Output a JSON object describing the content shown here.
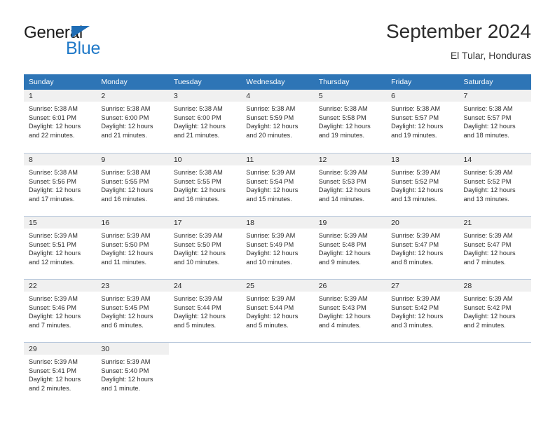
{
  "brand": {
    "name_part1": "General",
    "name_part2": "Blue",
    "logo_icon": "triangle-logo-icon"
  },
  "header": {
    "title": "September 2024",
    "location": "El Tular, Honduras"
  },
  "calendar": {
    "weekday_headers": [
      "Sunday",
      "Monday",
      "Tuesday",
      "Wednesday",
      "Thursday",
      "Friday",
      "Saturday"
    ],
    "header_bg_color": "#2e75b6",
    "daynum_band_color": "#f0f0f0",
    "grid_line_color": "#b9c9dc",
    "weeks": [
      [
        {
          "day": "1",
          "sunrise": "Sunrise: 5:38 AM",
          "sunset": "Sunset: 6:01 PM",
          "daylight_1": "Daylight: 12 hours",
          "daylight_2": "and 22 minutes."
        },
        {
          "day": "2",
          "sunrise": "Sunrise: 5:38 AM",
          "sunset": "Sunset: 6:00 PM",
          "daylight_1": "Daylight: 12 hours",
          "daylight_2": "and 21 minutes."
        },
        {
          "day": "3",
          "sunrise": "Sunrise: 5:38 AM",
          "sunset": "Sunset: 6:00 PM",
          "daylight_1": "Daylight: 12 hours",
          "daylight_2": "and 21 minutes."
        },
        {
          "day": "4",
          "sunrise": "Sunrise: 5:38 AM",
          "sunset": "Sunset: 5:59 PM",
          "daylight_1": "Daylight: 12 hours",
          "daylight_2": "and 20 minutes."
        },
        {
          "day": "5",
          "sunrise": "Sunrise: 5:38 AM",
          "sunset": "Sunset: 5:58 PM",
          "daylight_1": "Daylight: 12 hours",
          "daylight_2": "and 19 minutes."
        },
        {
          "day": "6",
          "sunrise": "Sunrise: 5:38 AM",
          "sunset": "Sunset: 5:57 PM",
          "daylight_1": "Daylight: 12 hours",
          "daylight_2": "and 19 minutes."
        },
        {
          "day": "7",
          "sunrise": "Sunrise: 5:38 AM",
          "sunset": "Sunset: 5:57 PM",
          "daylight_1": "Daylight: 12 hours",
          "daylight_2": "and 18 minutes."
        }
      ],
      [
        {
          "day": "8",
          "sunrise": "Sunrise: 5:38 AM",
          "sunset": "Sunset: 5:56 PM",
          "daylight_1": "Daylight: 12 hours",
          "daylight_2": "and 17 minutes."
        },
        {
          "day": "9",
          "sunrise": "Sunrise: 5:38 AM",
          "sunset": "Sunset: 5:55 PM",
          "daylight_1": "Daylight: 12 hours",
          "daylight_2": "and 16 minutes."
        },
        {
          "day": "10",
          "sunrise": "Sunrise: 5:38 AM",
          "sunset": "Sunset: 5:55 PM",
          "daylight_1": "Daylight: 12 hours",
          "daylight_2": "and 16 minutes."
        },
        {
          "day": "11",
          "sunrise": "Sunrise: 5:39 AM",
          "sunset": "Sunset: 5:54 PM",
          "daylight_1": "Daylight: 12 hours",
          "daylight_2": "and 15 minutes."
        },
        {
          "day": "12",
          "sunrise": "Sunrise: 5:39 AM",
          "sunset": "Sunset: 5:53 PM",
          "daylight_1": "Daylight: 12 hours",
          "daylight_2": "and 14 minutes."
        },
        {
          "day": "13",
          "sunrise": "Sunrise: 5:39 AM",
          "sunset": "Sunset: 5:52 PM",
          "daylight_1": "Daylight: 12 hours",
          "daylight_2": "and 13 minutes."
        },
        {
          "day": "14",
          "sunrise": "Sunrise: 5:39 AM",
          "sunset": "Sunset: 5:52 PM",
          "daylight_1": "Daylight: 12 hours",
          "daylight_2": "and 13 minutes."
        }
      ],
      [
        {
          "day": "15",
          "sunrise": "Sunrise: 5:39 AM",
          "sunset": "Sunset: 5:51 PM",
          "daylight_1": "Daylight: 12 hours",
          "daylight_2": "and 12 minutes."
        },
        {
          "day": "16",
          "sunrise": "Sunrise: 5:39 AM",
          "sunset": "Sunset: 5:50 PM",
          "daylight_1": "Daylight: 12 hours",
          "daylight_2": "and 11 minutes."
        },
        {
          "day": "17",
          "sunrise": "Sunrise: 5:39 AM",
          "sunset": "Sunset: 5:50 PM",
          "daylight_1": "Daylight: 12 hours",
          "daylight_2": "and 10 minutes."
        },
        {
          "day": "18",
          "sunrise": "Sunrise: 5:39 AM",
          "sunset": "Sunset: 5:49 PM",
          "daylight_1": "Daylight: 12 hours",
          "daylight_2": "and 10 minutes."
        },
        {
          "day": "19",
          "sunrise": "Sunrise: 5:39 AM",
          "sunset": "Sunset: 5:48 PM",
          "daylight_1": "Daylight: 12 hours",
          "daylight_2": "and 9 minutes."
        },
        {
          "day": "20",
          "sunrise": "Sunrise: 5:39 AM",
          "sunset": "Sunset: 5:47 PM",
          "daylight_1": "Daylight: 12 hours",
          "daylight_2": "and 8 minutes."
        },
        {
          "day": "21",
          "sunrise": "Sunrise: 5:39 AM",
          "sunset": "Sunset: 5:47 PM",
          "daylight_1": "Daylight: 12 hours",
          "daylight_2": "and 7 minutes."
        }
      ],
      [
        {
          "day": "22",
          "sunrise": "Sunrise: 5:39 AM",
          "sunset": "Sunset: 5:46 PM",
          "daylight_1": "Daylight: 12 hours",
          "daylight_2": "and 7 minutes."
        },
        {
          "day": "23",
          "sunrise": "Sunrise: 5:39 AM",
          "sunset": "Sunset: 5:45 PM",
          "daylight_1": "Daylight: 12 hours",
          "daylight_2": "and 6 minutes."
        },
        {
          "day": "24",
          "sunrise": "Sunrise: 5:39 AM",
          "sunset": "Sunset: 5:44 PM",
          "daylight_1": "Daylight: 12 hours",
          "daylight_2": "and 5 minutes."
        },
        {
          "day": "25",
          "sunrise": "Sunrise: 5:39 AM",
          "sunset": "Sunset: 5:44 PM",
          "daylight_1": "Daylight: 12 hours",
          "daylight_2": "and 5 minutes."
        },
        {
          "day": "26",
          "sunrise": "Sunrise: 5:39 AM",
          "sunset": "Sunset: 5:43 PM",
          "daylight_1": "Daylight: 12 hours",
          "daylight_2": "and 4 minutes."
        },
        {
          "day": "27",
          "sunrise": "Sunrise: 5:39 AM",
          "sunset": "Sunset: 5:42 PM",
          "daylight_1": "Daylight: 12 hours",
          "daylight_2": "and 3 minutes."
        },
        {
          "day": "28",
          "sunrise": "Sunrise: 5:39 AM",
          "sunset": "Sunset: 5:42 PM",
          "daylight_1": "Daylight: 12 hours",
          "daylight_2": "and 2 minutes."
        }
      ],
      [
        {
          "day": "29",
          "sunrise": "Sunrise: 5:39 AM",
          "sunset": "Sunset: 5:41 PM",
          "daylight_1": "Daylight: 12 hours",
          "daylight_2": "and 2 minutes."
        },
        {
          "day": "30",
          "sunrise": "Sunrise: 5:39 AM",
          "sunset": "Sunset: 5:40 PM",
          "daylight_1": "Daylight: 12 hours",
          "daylight_2": "and 1 minute."
        },
        null,
        null,
        null,
        null,
        null
      ]
    ]
  }
}
